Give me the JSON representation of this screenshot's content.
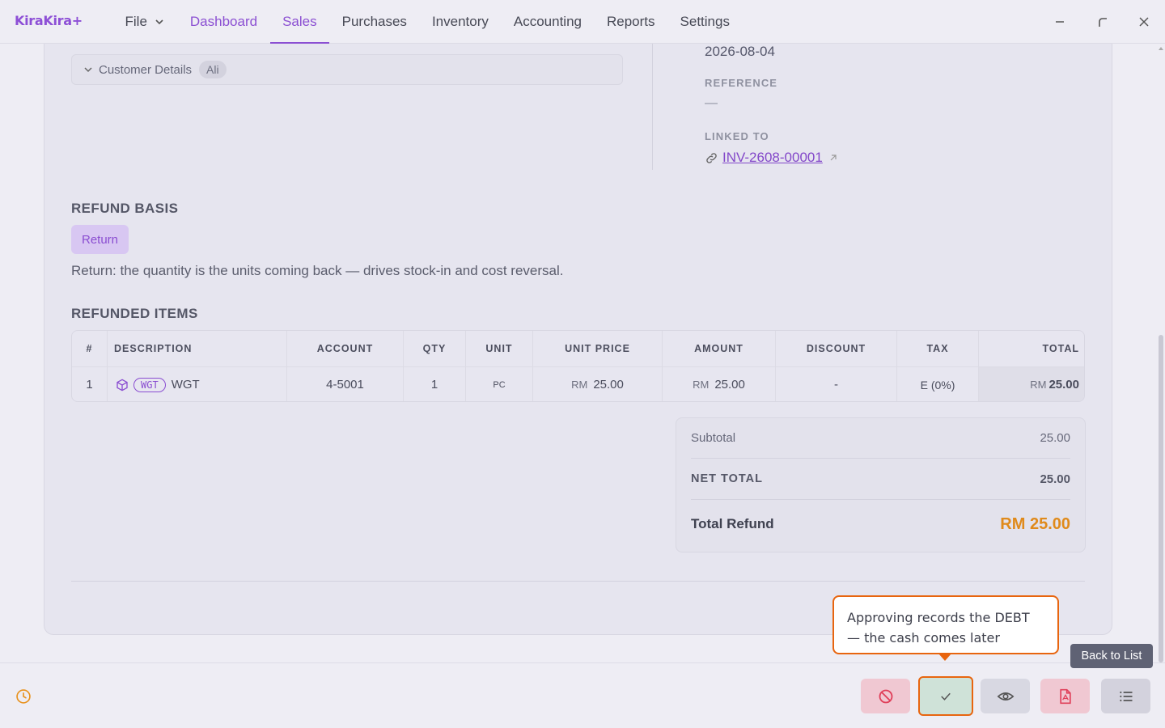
{
  "app": {
    "brand": "KiraKira+"
  },
  "menu": {
    "file": "File",
    "items": [
      "Dashboard",
      "Sales",
      "Purchases",
      "Inventory",
      "Accounting",
      "Reports",
      "Settings"
    ]
  },
  "customer": {
    "label": "Customer Details",
    "pill": "Ali"
  },
  "details": {
    "date": "2026-08-04",
    "reference_label": "REFERENCE",
    "reference_value": "—",
    "linked_label": "LINKED TO",
    "linked_value": "INV-2608-00001"
  },
  "refund_basis": {
    "title": "REFUND BASIS",
    "chip": "Return",
    "description": "Return: the quantity is the units coming back — drives stock-in and cost reversal."
  },
  "items": {
    "title": "REFUNDED ITEMS",
    "headers": [
      "#",
      "DESCRIPTION",
      "ACCOUNT",
      "QTY",
      "UNIT",
      "UNIT PRICE",
      "AMOUNT",
      "DISCOUNT",
      "TAX",
      "TOTAL"
    ],
    "rows": [
      {
        "no": "1",
        "tag": "WGT",
        "description": "WGT",
        "account": "4-5001",
        "qty": "1",
        "unit": "PC",
        "currency": "RM",
        "unit_price": "25.00",
        "amount": "25.00",
        "discount": "-",
        "tax": "E (0%)",
        "total": "25.00"
      }
    ]
  },
  "totals": {
    "subtotal_label": "Subtotal",
    "subtotal": "25.00",
    "net_label": "NET TOTAL",
    "net": "25.00",
    "refund_label": "Total Refund",
    "refund": "RM 25.00"
  },
  "tooltip": {
    "text": "Approving records the DEBT — the cash comes later"
  },
  "back_tooltip": "Back to List",
  "colors": {
    "accent": "#8b4fd2",
    "highlight": "#e8650f",
    "refund_total": "#e08a1b"
  }
}
